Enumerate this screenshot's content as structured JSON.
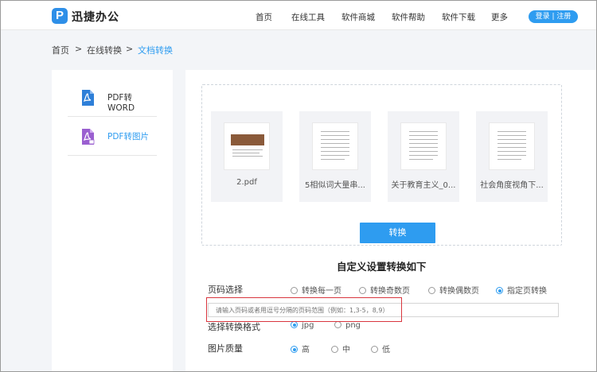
{
  "header": {
    "logo_letter": "P",
    "brand": "迅捷办公",
    "nav": [
      "首页",
      "在线工具",
      "软件商城",
      "软件帮助",
      "软件下载",
      "更多"
    ],
    "login": "登录 | 注册",
    "accent": "#2e9cf0"
  },
  "breadcrumb": [
    "首页",
    ">",
    "在线转换",
    ">",
    "文档转换"
  ],
  "sidebar": {
    "items": [
      {
        "label": "PDF转WORD",
        "icon": "pdf-to-word-icon",
        "color": "#2e7fd8"
      },
      {
        "label": "PDF转图片",
        "icon": "pdf-to-image-icon",
        "color": "#9a5fd0"
      }
    ]
  },
  "files": [
    {
      "name": "2.pdf"
    },
    {
      "name": "5相似词大量串..."
    },
    {
      "name": "关于教育主义_0..."
    },
    {
      "name": "社会角度视角下..."
    }
  ],
  "convert_label": "转换",
  "settings": {
    "title": "自定义设置转换如下",
    "page_select": {
      "label": "页码选择",
      "options": [
        "转换每一页",
        "转换奇数页",
        "转换偶数页",
        "指定页转换"
      ],
      "selected": "指定页转换"
    },
    "page_input_placeholder": "请输入页码或者用逗号分隔的页码范围（例如：1,3-5，8,9）",
    "format": {
      "label": "选择转换格式",
      "options": [
        "jpg",
        "png"
      ],
      "selected": "jpg"
    },
    "quality": {
      "label": "图片质量",
      "options": [
        "高",
        "中",
        "低"
      ],
      "selected": "高"
    }
  }
}
